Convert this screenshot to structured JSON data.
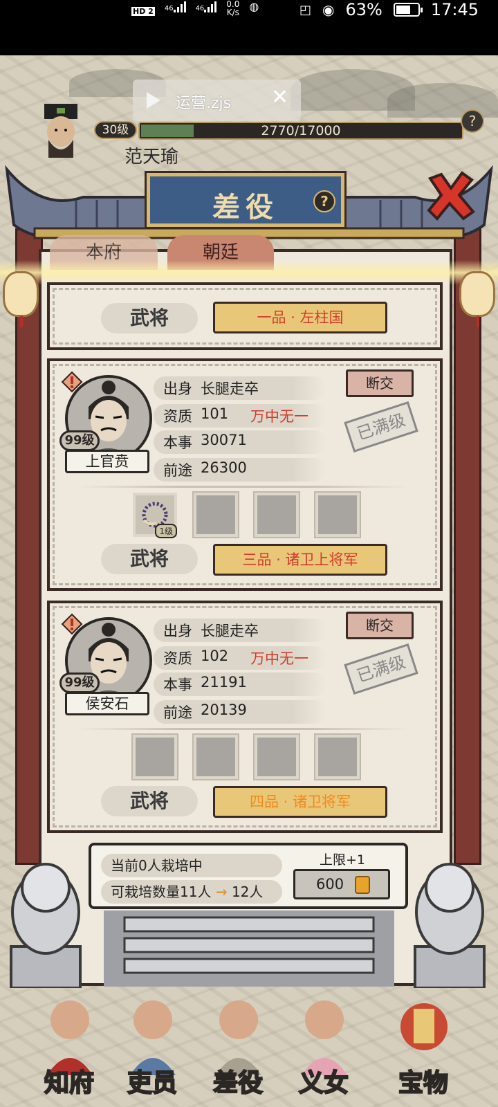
{
  "status_bar": {
    "hd_label": "HD 2",
    "net_label_1": "46",
    "net_label_2": "46",
    "speed_value": "0.0",
    "speed_unit": "K/s",
    "battery": "63%",
    "time": "17:45"
  },
  "hud": {
    "level": "30级",
    "xp_text": "2770/17000",
    "xp_fraction": 0.163,
    "name": "范天瑜",
    "help_icon": "question-icon"
  },
  "video_overlay": {
    "label": "运营.zjs",
    "close_glyph": "✕"
  },
  "panel": {
    "title": "差役",
    "help_glyph": "?",
    "tabs": [
      {
        "label": "本府",
        "active": false
      },
      {
        "label": "朝廷",
        "active": true
      }
    ]
  },
  "cards": {
    "top": {
      "role": "武将",
      "rank": "一品 · 左柱国"
    },
    "a": {
      "level": "99级",
      "name": "上官贲",
      "origin_key": "出身",
      "origin_val": "长腿走卒",
      "talent_key": "资质",
      "talent_val": "101",
      "talent_tag": "万中无一",
      "skill_key": "本事",
      "skill_val": "30071",
      "prospect_key": "前途",
      "prospect_val": "26300",
      "break_label": "断交",
      "maxed_label": "已满级",
      "item_level": "1级",
      "role": "武将",
      "rank": "三品 · 诸卫上将军"
    },
    "b": {
      "level": "99级",
      "name": "侯安石",
      "origin_key": "出身",
      "origin_val": "长腿走卒",
      "talent_key": "资质",
      "talent_val": "102",
      "talent_tag": "万中无一",
      "skill_key": "本事",
      "skill_val": "21191",
      "prospect_key": "前途",
      "prospect_val": "20139",
      "break_label": "断交",
      "maxed_label": "已满级",
      "role": "武将",
      "rank": "四品 · 诸卫将军"
    }
  },
  "footer_info": {
    "current": "当前0人栽培中",
    "capacity_prefix": "可栽培数量11人",
    "capacity_arrow": "→",
    "capacity_next": "12人",
    "cap_label": "上限+1",
    "cap_cost": "600"
  },
  "bottom_nav": [
    {
      "label": "知府"
    },
    {
      "label": "吏员"
    },
    {
      "label": "差役"
    },
    {
      "label": "义女"
    },
    {
      "label": "宝物"
    }
  ],
  "colors": {
    "title_plaque": "#3e5d86",
    "rank_red": "#d23b2b",
    "rank_orange": "#f08a1d",
    "pillar": "#7c3a33"
  }
}
